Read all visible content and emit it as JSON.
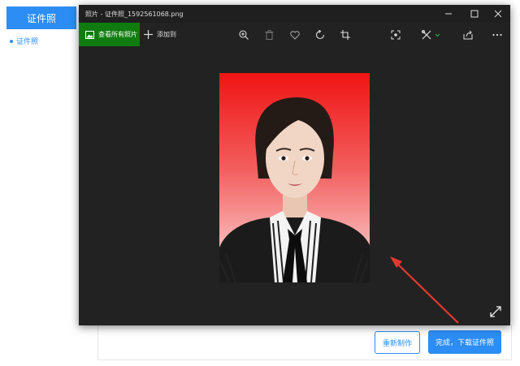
{
  "background_app": {
    "sidebar_title": "证件照",
    "sidebar_item": "证件照",
    "redo_button": "重新制作",
    "done_button": "完成，下载证件照"
  },
  "photo_window": {
    "title": "照片 - 证件照_1592561068.png",
    "window_controls": {
      "minimize": "—",
      "maximize": "☐",
      "close": "✕"
    },
    "toolbar": {
      "all_photos_label": "查看所有照片",
      "add_to_label": "添加到",
      "tools": [
        "zoom-in-icon",
        "delete-icon",
        "favorite-icon",
        "rotate-icon",
        "crop-icon",
        "enhance-icon",
        "edit-draw-icon",
        "share-icon",
        "more-icon"
      ]
    },
    "image": {
      "description_type": "portrait-id-photo",
      "background_gradient": [
        "#f01414",
        "#fbe1e1"
      ]
    }
  },
  "annotation": {
    "arrow_color": "#e0392f"
  },
  "colors": {
    "accent": "#2c8df4",
    "green": "#107c10",
    "dark": "#222222"
  }
}
